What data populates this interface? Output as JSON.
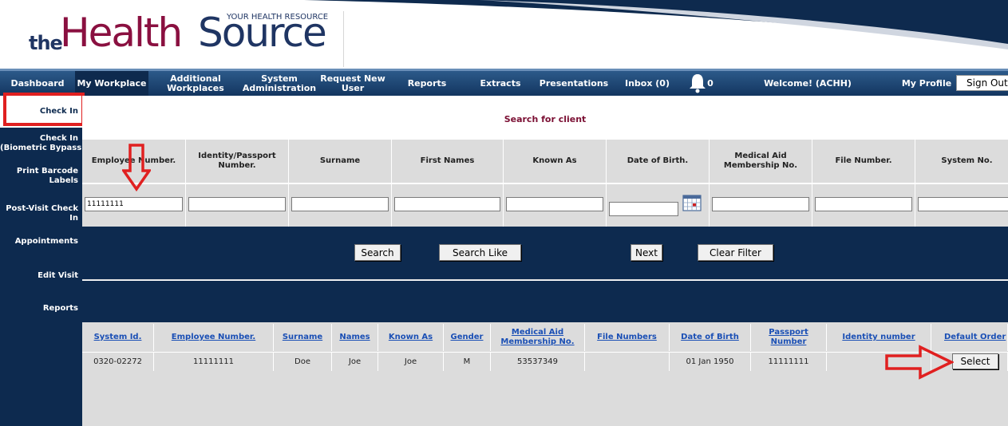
{
  "header": {
    "logo_the": "the",
    "logo_health": "Health",
    "logo_source": "Source",
    "tagline": "YOUR HEALTH RESOURCE"
  },
  "nav": {
    "items": [
      {
        "label": "Dashboard"
      },
      {
        "label": "My Workplace"
      },
      {
        "label": "Additional\nWorkplaces"
      },
      {
        "label": "System\nAdministration"
      },
      {
        "label": "Request New\nUser"
      },
      {
        "label": "Reports"
      },
      {
        "label": "Extracts"
      },
      {
        "label": "Presentations"
      },
      {
        "label": "Inbox (0)"
      }
    ],
    "notification_count": "0",
    "welcome": "Welcome! (ACHH)",
    "my_profile": "My Profile",
    "sign_out": "Sign Out"
  },
  "sidebar": {
    "items": [
      {
        "label": "Check In"
      },
      {
        "label": "Check In\n(Biometric Bypass)"
      },
      {
        "label": "Print Barcode\nLabels"
      },
      {
        "label": "Post-Visit Check In"
      },
      {
        "label": "Appointments"
      },
      {
        "label": "Edit Visit"
      },
      {
        "label": "Reports"
      }
    ]
  },
  "search": {
    "title": "Search for client",
    "columns": [
      {
        "label": "Employee Number.",
        "value": "11111111"
      },
      {
        "label": "Identity/Passport\nNumber.",
        "value": ""
      },
      {
        "label": "Surname",
        "value": ""
      },
      {
        "label": "First Names",
        "value": ""
      },
      {
        "label": "Known As",
        "value": ""
      },
      {
        "label": "Date of Birth.",
        "value": ""
      },
      {
        "label": "Medical Aid\nMembership No.",
        "value": ""
      },
      {
        "label": "File Number.",
        "value": ""
      },
      {
        "label": "System No.",
        "value": ""
      }
    ],
    "buttons": {
      "search": "Search",
      "search_like": "Search Like",
      "next": "Next",
      "clear_filter": "Clear Filter"
    }
  },
  "results": {
    "headers": [
      "System Id.",
      "Employee Number.",
      "Surname",
      "Names",
      "Known As",
      "Gender",
      "Medical Aid\nMembership No.",
      "File Numbers",
      "Date of Birth",
      "Passport\nNumber",
      "Identity number",
      "Default Order"
    ],
    "rows": [
      {
        "cells": [
          "0320-02272",
          "11111111",
          "Doe",
          "Joe",
          "Joe",
          "M",
          "53537349",
          "",
          "01 Jan 1950",
          "11111111",
          ""
        ],
        "select_label": "Select"
      }
    ]
  },
  "colors": {
    "navy": "#0d2a4f",
    "maroon": "#7b0f33",
    "link_blue": "#1a4fb5",
    "highlight_red": "#e02020"
  }
}
